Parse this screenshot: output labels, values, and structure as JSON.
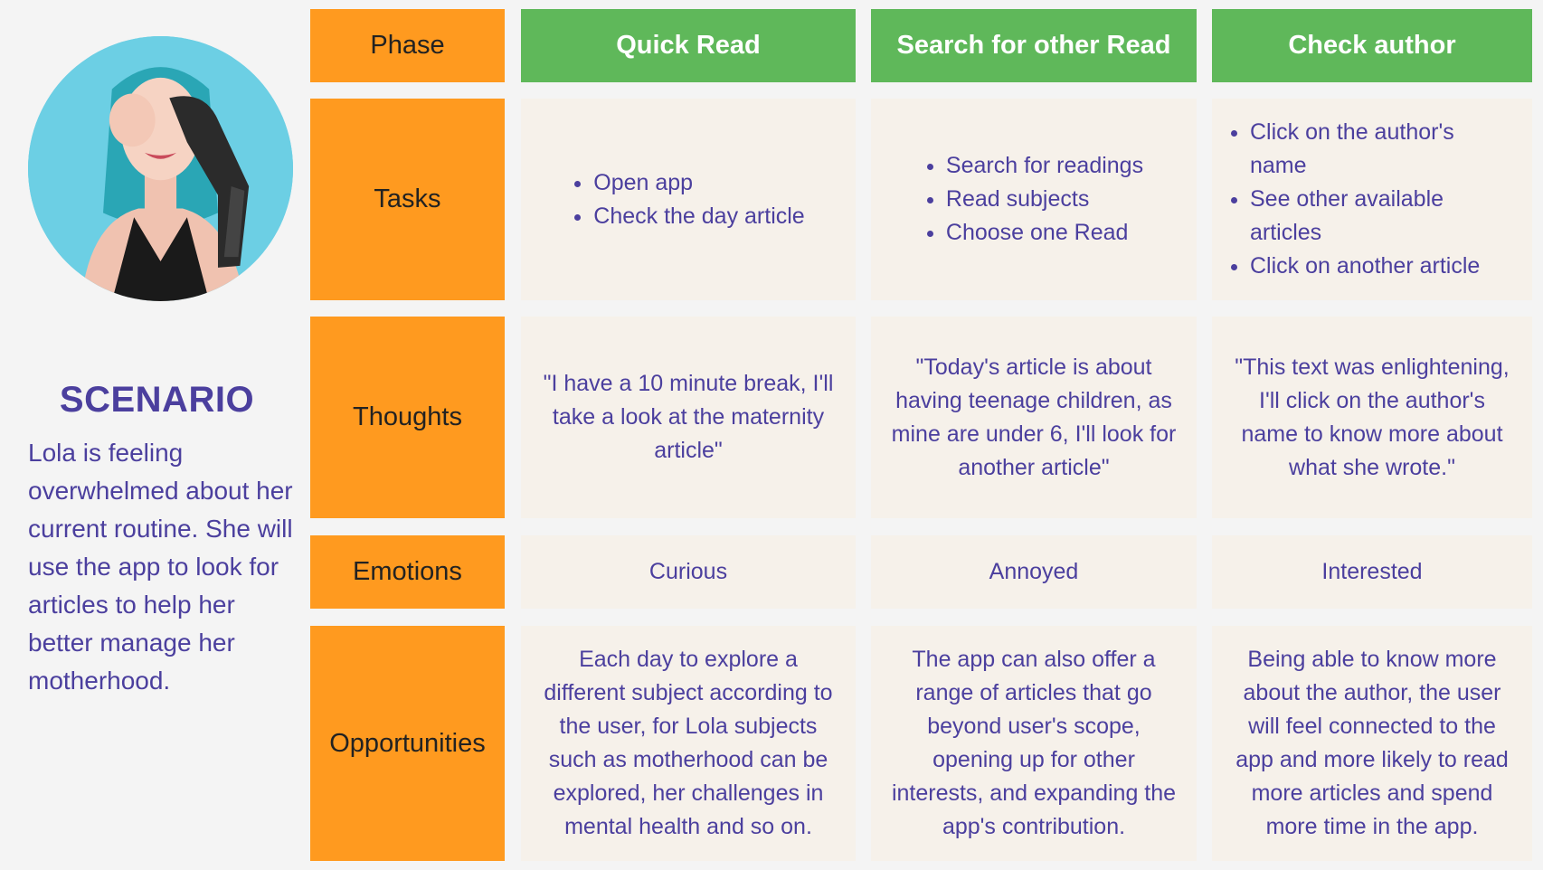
{
  "scenario": {
    "title": "SCENARIO",
    "text": "Lola is feeling overwhelmed about her current routine. She will use the app to look for articles to help her better manage her motherhood."
  },
  "phase_label": "Phase",
  "row_labels": {
    "tasks": "Tasks",
    "thoughts": "Thoughts",
    "emotions": "Emotions",
    "opportunities": "Opportunities"
  },
  "phases": [
    {
      "name": "Quick Read",
      "tasks": [
        "Open app",
        "Check the day article"
      ],
      "thought": "\"I have a 10 minute break, I'll take a look at the maternity article\"",
      "emotion": "Curious",
      "opportunity": "Each day to explore a different subject according to the user, for Lola subjects such as motherhood can be explored, her challenges in mental health and so on."
    },
    {
      "name": "Search for other Read",
      "tasks": [
        "Search for readings",
        "Read subjects",
        "Choose one Read"
      ],
      "thought": "\"Today's article is about having teenage children, as mine are under 6, I'll look for another article\"",
      "emotion": "Annoyed",
      "opportunity": "The app can also offer a range of articles that go beyond user's scope, opening up for other interests, and expanding the app's contribution."
    },
    {
      "name": "Check author",
      "tasks": [
        "Click on the author's name",
        "See other available articles",
        "Click on another article"
      ],
      "thought": "\"This text was enlightening, I'll click on the author's name to know more about what she wrote.\"",
      "emotion": "Interested",
      "opportunity": "Being able to know more about the author, the user will feel connected to the app and more likely to read more articles and spend more time in the app."
    }
  ],
  "icons": {
    "avatar": "persona-photo"
  }
}
